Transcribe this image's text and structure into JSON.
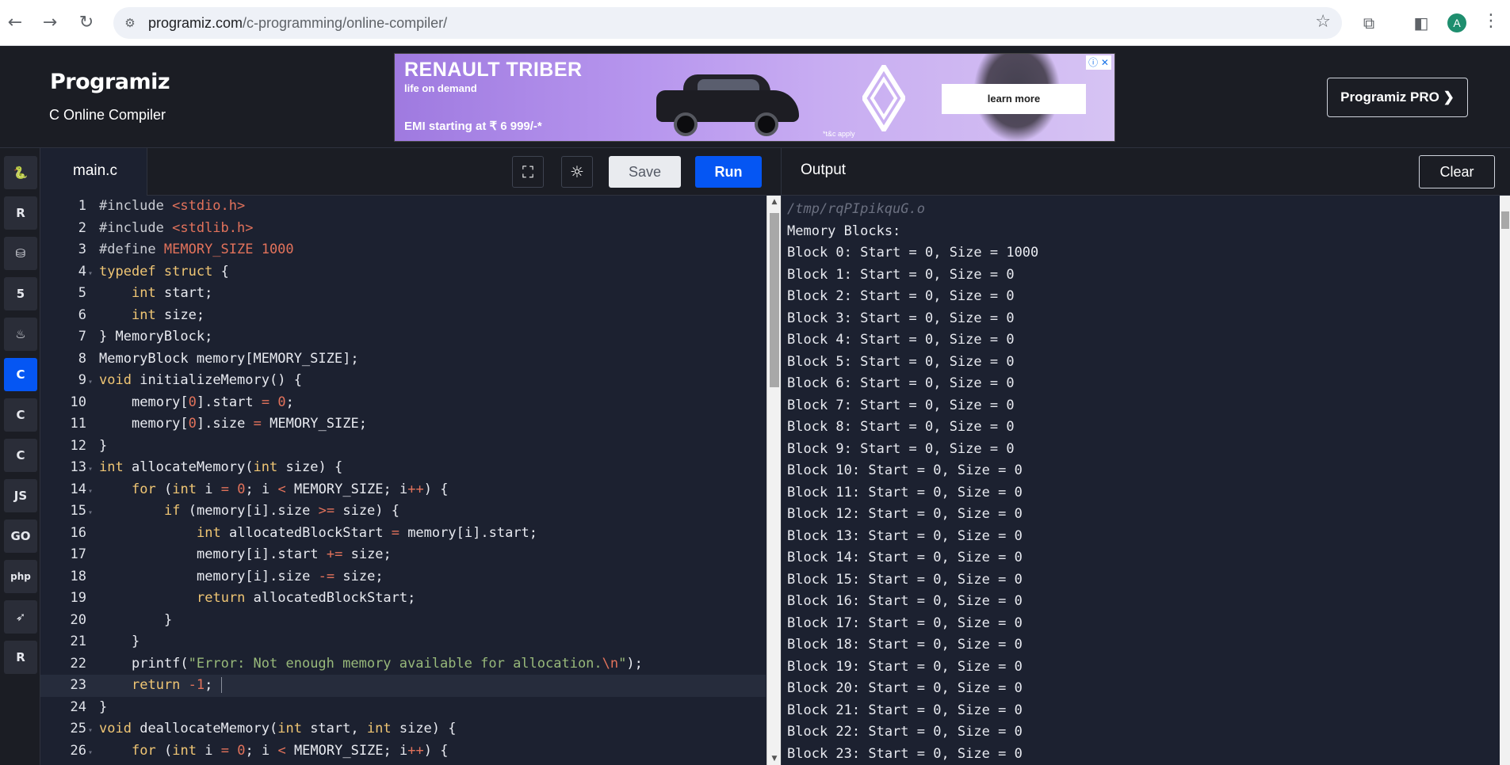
{
  "browser": {
    "url_host": "programiz.com",
    "url_path": "/c-programming/online-compiler/",
    "avatar_letter": "A"
  },
  "header": {
    "logo": "Programiz",
    "subtitle": "C Online Compiler",
    "pro_button": "Programiz PRO ❯"
  },
  "ad": {
    "brand": "RENAULT TRIBER",
    "tagline": "life on demand",
    "emi": "EMI starting at ₹ 6 999/-*",
    "cta": "learn more",
    "terms": "*t&c apply"
  },
  "languages": [
    {
      "name": "python-icon",
      "glyph": "🐍"
    },
    {
      "name": "r-icon",
      "glyph": "R"
    },
    {
      "name": "sql-icon",
      "glyph": "⛁"
    },
    {
      "name": "html-icon",
      "glyph": "5"
    },
    {
      "name": "java-icon",
      "glyph": "♨"
    },
    {
      "name": "c-icon",
      "glyph": "C"
    },
    {
      "name": "cpp-icon",
      "glyph": "C"
    },
    {
      "name": "csharp-icon",
      "glyph": "C"
    },
    {
      "name": "js-icon",
      "glyph": "JS"
    },
    {
      "name": "go-icon",
      "glyph": "GO"
    },
    {
      "name": "php-icon",
      "glyph": "php"
    },
    {
      "name": "swift-icon",
      "glyph": "➶"
    },
    {
      "name": "rust-icon",
      "glyph": "R"
    }
  ],
  "editor": {
    "filename": "main.c",
    "save_label": "Save",
    "run_label": "Run"
  },
  "output": {
    "title": "Output",
    "clear_label": "Clear",
    "lines": [
      "/tmp/rqPIpikquG.o",
      "Memory Blocks:",
      "Block 0: Start = 0, Size = 1000",
      "Block 1: Start = 0, Size = 0",
      "Block 2: Start = 0, Size = 0",
      "Block 3: Start = 0, Size = 0",
      "Block 4: Start = 0, Size = 0",
      "Block 5: Start = 0, Size = 0",
      "Block 6: Start = 0, Size = 0",
      "Block 7: Start = 0, Size = 0",
      "Block 8: Start = 0, Size = 0",
      "Block 9: Start = 0, Size = 0",
      "Block 10: Start = 0, Size = 0",
      "Block 11: Start = 0, Size = 0",
      "Block 12: Start = 0, Size = 0",
      "Block 13: Start = 0, Size = 0",
      "Block 14: Start = 0, Size = 0",
      "Block 15: Start = 0, Size = 0",
      "Block 16: Start = 0, Size = 0",
      "Block 17: Start = 0, Size = 0",
      "Block 18: Start = 0, Size = 0",
      "Block 19: Start = 0, Size = 0",
      "Block 20: Start = 0, Size = 0",
      "Block 21: Start = 0, Size = 0",
      "Block 22: Start = 0, Size = 0",
      "Block 23: Start = 0, Size = 0"
    ]
  },
  "code_lines": [
    {
      "n": "1",
      "text": "#include <stdio.h>"
    },
    {
      "n": "2",
      "text": "#include <stdlib.h>"
    },
    {
      "n": "3",
      "text": "#define MEMORY_SIZE 1000"
    },
    {
      "n": "4",
      "text": "typedef struct {"
    },
    {
      "n": "5",
      "text": "    int start;"
    },
    {
      "n": "6",
      "text": "    int size;"
    },
    {
      "n": "7",
      "text": "} MemoryBlock;"
    },
    {
      "n": "8",
      "text": "MemoryBlock memory[MEMORY_SIZE];"
    },
    {
      "n": "9",
      "text": "void initializeMemory() {"
    },
    {
      "n": "10",
      "text": "    memory[0].start = 0;"
    },
    {
      "n": "11",
      "text": "    memory[0].size = MEMORY_SIZE;"
    },
    {
      "n": "12",
      "text": "}"
    },
    {
      "n": "13",
      "text": "int allocateMemory(int size) {"
    },
    {
      "n": "14",
      "text": "    for (int i = 0; i < MEMORY_SIZE; i++) {"
    },
    {
      "n": "15",
      "text": "        if (memory[i].size >= size) {"
    },
    {
      "n": "16",
      "text": "            int allocatedBlockStart = memory[i].start;"
    },
    {
      "n": "17",
      "text": "            memory[i].start += size;"
    },
    {
      "n": "18",
      "text": "            memory[i].size -= size;"
    },
    {
      "n": "19",
      "text": "            return allocatedBlockStart;"
    },
    {
      "n": "20",
      "text": "        }"
    },
    {
      "n": "21",
      "text": "    }"
    },
    {
      "n": "22",
      "text": "    printf(\"Error: Not enough memory available for allocation.\\n\");"
    },
    {
      "n": "23",
      "text": "    return -1;"
    },
    {
      "n": "24",
      "text": "}"
    },
    {
      "n": "25",
      "text": "void deallocateMemory(int start, int size) {"
    },
    {
      "n": "26",
      "text": "    for (int i = 0; i < MEMORY_SIZE; i++) {"
    }
  ],
  "colors": {
    "accent": "#0556f3",
    "editor_bg": "#1c2130",
    "keyword": "#f0c674",
    "string": "#e2725b"
  }
}
